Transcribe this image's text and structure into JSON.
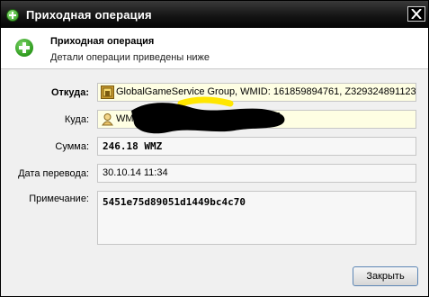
{
  "window": {
    "title": "Приходная операция",
    "close_icon": "close-icon"
  },
  "header": {
    "title": "Приходная операция",
    "subtitle": "Детали операции приведены ниже",
    "icon": "plus-icon"
  },
  "fields": {
    "from": {
      "label": "Откуда:",
      "value": "GlobalGameService Group, WMID: 161859894761, Z329324891123",
      "icon": "merchant-icon"
    },
    "to": {
      "label": "Куда:",
      "value": "WMID",
      "icon": "user-icon"
    },
    "amount": {
      "label": "Сумма:",
      "value": "246.18 WMZ"
    },
    "date": {
      "label": "Дата перевода:",
      "value": "30.10.14 11:34"
    },
    "note": {
      "label": "Примечание:",
      "value": "5451e75d89051d1449bc4c70"
    }
  },
  "buttons": {
    "close_label": "Закрыть"
  },
  "colors": {
    "title_bar": "#0a0a0a",
    "header_icon": "#2d9a1d",
    "highlight_field": "#fefee3",
    "button_border": "#5c86b5",
    "redaction": "#000000"
  }
}
